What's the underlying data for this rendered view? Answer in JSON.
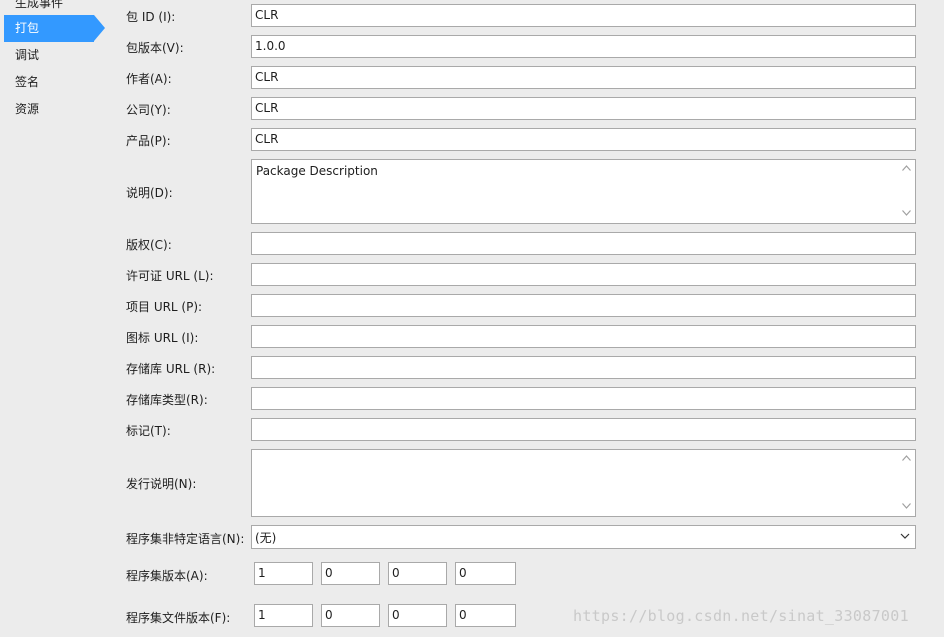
{
  "sidebar": {
    "items": [
      {
        "label": "生成事件",
        "selected": false
      },
      {
        "label": "打包",
        "selected": true
      },
      {
        "label": "调试",
        "selected": false
      },
      {
        "label": "签名",
        "selected": false
      },
      {
        "label": "资源",
        "selected": false
      }
    ],
    "selected_color": "#3399ff"
  },
  "form": {
    "package_id": {
      "label": "包 ID (I):",
      "value": "CLR"
    },
    "package_version": {
      "label": "包版本(V):",
      "value": "1.0.0"
    },
    "authors": {
      "label": "作者(A):",
      "value": "CLR"
    },
    "company": {
      "label": "公司(Y):",
      "value": "CLR"
    },
    "product": {
      "label": "产品(P):",
      "value": "CLR"
    },
    "description": {
      "label": "说明(D):",
      "value": "Package Description"
    },
    "copyright": {
      "label": "版权(C):",
      "value": ""
    },
    "license_url": {
      "label": "许可证 URL (L):",
      "value": ""
    },
    "project_url": {
      "label": "项目 URL (P):",
      "value": ""
    },
    "icon_url": {
      "label": "图标 URL (I):",
      "value": ""
    },
    "repository_url": {
      "label": "存储库 URL (R):",
      "value": ""
    },
    "repository_type": {
      "label": "存储库类型(R):",
      "value": ""
    },
    "tags": {
      "label": "标记(T):",
      "value": ""
    },
    "release_notes": {
      "label": "发行说明(N):",
      "value": ""
    },
    "neutral_language": {
      "label": "程序集非特定语言(N):",
      "value": "(无)"
    },
    "assembly_version": {
      "label": "程序集版本(A):",
      "parts": [
        "1",
        "0",
        "0",
        "0"
      ]
    },
    "file_version": {
      "label": "程序集文件版本(F):",
      "parts": [
        "1",
        "0",
        "0",
        "0"
      ]
    }
  },
  "icons": {
    "scroll_up": "chevron-up-icon",
    "scroll_down": "chevron-down-icon",
    "dropdown": "chevron-down-icon"
  },
  "watermark": "https://blog.csdn.net/sinat_33087001"
}
